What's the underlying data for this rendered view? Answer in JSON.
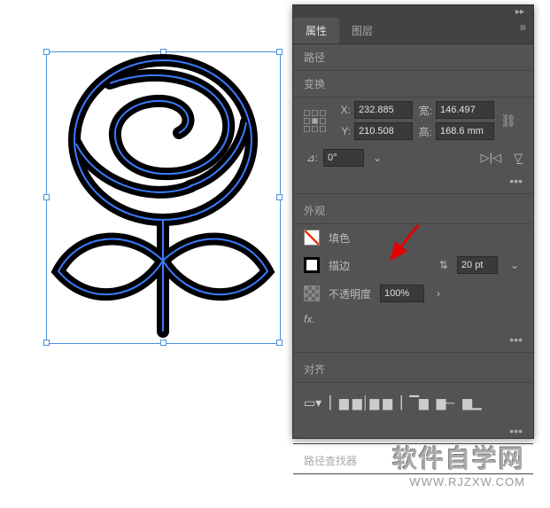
{
  "panel": {
    "tabs": {
      "properties": "属性",
      "layers": "图层"
    },
    "pathLabel": "路径",
    "transformLabel": "变换",
    "fields": {
      "xLabel": "X:",
      "xValue": "232.885",
      "yLabel": "Y:",
      "yValue": "210.508",
      "wLabel": "宽:",
      "wValue": "146.497",
      "hLabel": "高:",
      "hValue": "168.6 mm",
      "angleLabel": "⊿:",
      "angleValue": "0°"
    },
    "appearanceLabel": "外观",
    "fillLabel": "填色",
    "strokeLabel": "描边",
    "strokeValue": "20 pt",
    "opacityLabel": "不透明度",
    "opacityValue": "100%",
    "fxLabel": "fx.",
    "alignLabel": "对齐",
    "pathfinderLabel": "路径查找器",
    "moreDots": "•••"
  },
  "watermark": {
    "line1": "软件自学网",
    "line2": "WWW.RJZXW.COM"
  }
}
